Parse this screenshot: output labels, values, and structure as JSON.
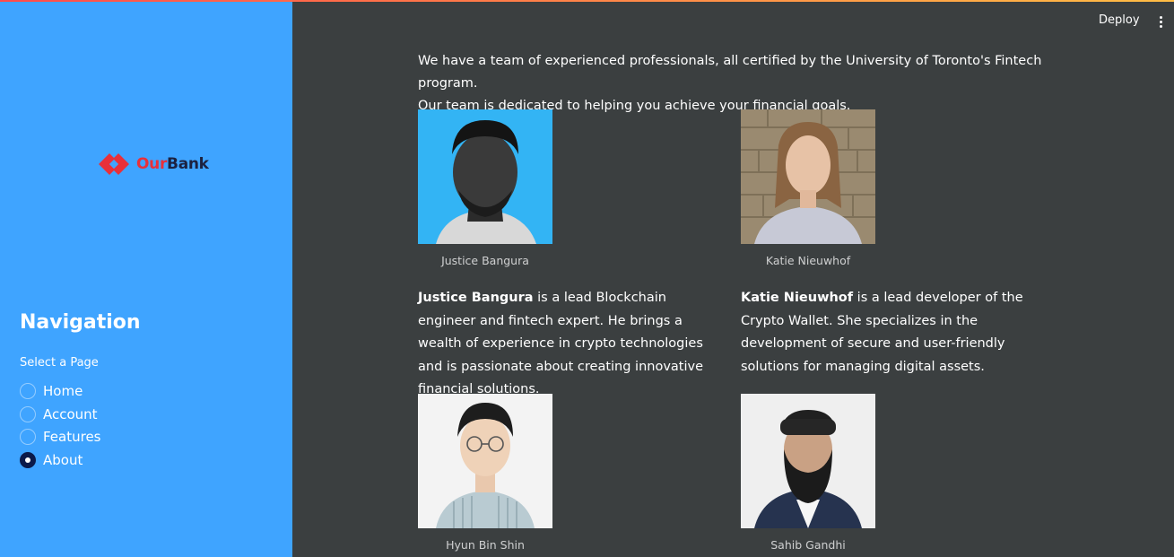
{
  "header": {
    "deploy_label": "Deploy",
    "menu_icon": "kebab-menu-icon"
  },
  "sidebar": {
    "logo": {
      "part1": "Our",
      "part2": "Bank",
      "icon": "ourbank-logo-icon"
    },
    "title": "Navigation",
    "select_label": "Select a Page",
    "options": [
      {
        "label": "Home",
        "selected": false
      },
      {
        "label": "Account",
        "selected": false
      },
      {
        "label": "Features",
        "selected": false
      },
      {
        "label": "About",
        "selected": true
      }
    ]
  },
  "main": {
    "intro_line1": "We have a team of experienced professionals, all certified by the University of Toronto's Fintech program.",
    "intro_line2": "Our team is dedicated to helping you achieve your financial goals.",
    "team": [
      {
        "name": "Justice Bangura",
        "caption": "Justice Bangura",
        "bio": " is a lead Blockchain engineer and fintech expert. He brings a wealth of experience in crypto technologies and is passionate about creating innovative financial solutions."
      },
      {
        "name": "Katie Nieuwhof",
        "caption": "Katie Nieuwhof",
        "bio": " is a lead developer of the Crypto Wallet. She specializes in the development of secure and user-friendly solutions for managing digital assets."
      },
      {
        "name": "Hyun Bin Shin",
        "caption": "Hyun Bin Shin"
      },
      {
        "name": "Sahib Gandhi",
        "caption": "Sahib Gandhi"
      }
    ]
  },
  "colors": {
    "sidebar": "#3fa4ff",
    "main_bg": "#3b3f40",
    "logo_red": "#e8303a",
    "logo_navy": "#1c2240",
    "radio_selected": "#0b1a4a"
  }
}
